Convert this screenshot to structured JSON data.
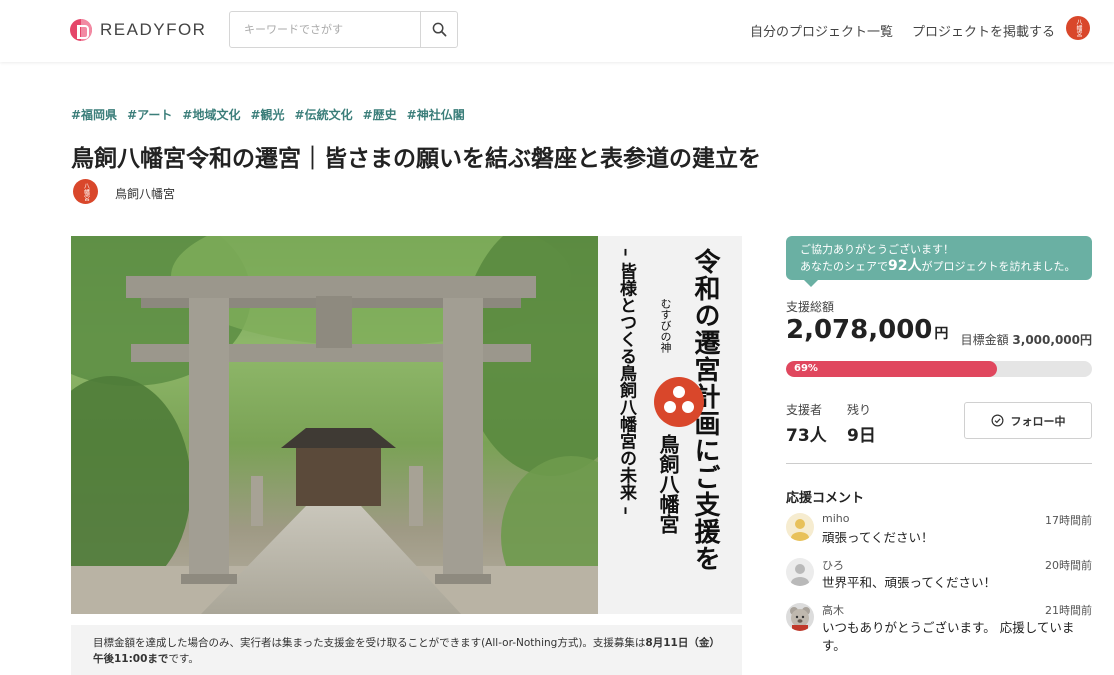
{
  "header": {
    "logo_text": "READYFOR",
    "search_placeholder": "キーワードでさがす",
    "nav": {
      "my_projects": "自分のプロジェクト一覧",
      "post_project": "プロジェクトを掲載する"
    },
    "user_avatar_text": "八幡宮"
  },
  "project": {
    "tags": [
      "#福岡県",
      "#アート",
      "#地域文化",
      "#観光",
      "#伝統文化",
      "#歴史",
      "#神社仏閣"
    ],
    "title": "鳥飼八幡宮令和の遷宮｜皆さまの願いを結ぶ磐座と表参道の建立を",
    "owner_name": "鳥飼八幡宮",
    "owner_avatar_text": "八幡宮"
  },
  "hero": {
    "main_copy": "令和の遷宮計画にご支援を",
    "sub_copy": "– 皆様とつくる鳥飼八幡宮の未来 –",
    "small_copy": "むすびの神",
    "shrine_name": "鳥飼八幡宮",
    "emblem_color": "#d9472b"
  },
  "notice": {
    "text": "目標金額を達成した場合のみ、実行者は集まった支援金を受け取ることができます(All-or-Nothing方式)。支援募集は",
    "deadline": "8月11日（金）午後11:00まで",
    "suffix": "です。"
  },
  "funding": {
    "bubble_line1": "ご協力ありがとうございます！",
    "bubble_line2_prefix": "あなたのシェアで",
    "bubble_count": "92人",
    "bubble_line2_suffix": "がプロジェクトを訪れました。",
    "total_label": "支援総額",
    "total_amount": "2,078,000",
    "yen": "円",
    "goal_label": "目標金額",
    "goal_amount": "3,000,000円",
    "progress_percent": 69,
    "progress_text": "69%",
    "supporters_label": "支援者",
    "supporters_value": "73人",
    "remaining_label": "残り",
    "remaining_value": "9日",
    "follow_label": "フォロー中",
    "accent_color": "#e0475e",
    "bubble_color": "#6ab0a3"
  },
  "comments": {
    "heading": "応援コメント",
    "items": [
      {
        "name": "miho",
        "time": "17時間前",
        "text": "頑張ってください！"
      },
      {
        "name": "ひろ",
        "time": "20時間前",
        "text": "世界平和、頑張ってください！"
      },
      {
        "name": "高木",
        "time": "21時間前",
        "text": "いつもありがとうございます。 応援しています。"
      }
    ]
  }
}
